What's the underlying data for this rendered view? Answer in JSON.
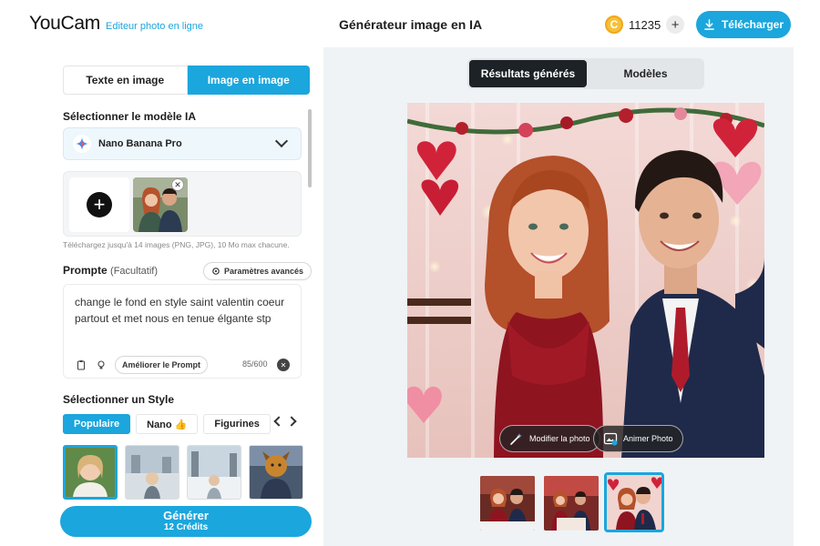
{
  "header": {
    "logo_word": "YouCam",
    "logo_sub": "Editeur photo en ligne",
    "title": "Générateur image en IA",
    "credits": "11235",
    "download_label": "Télécharger"
  },
  "left": {
    "tabs": [
      {
        "label": "Texte en image",
        "active": false
      },
      {
        "label": "Image en image",
        "active": true
      }
    ],
    "model_section_label": "Sélectionner le modèle IA",
    "model_name": "Nano Banana Pro",
    "upload_hint": "Téléchargez jusqu'à 14 images (PNG, JPG), 10 Mo max chacune.",
    "prompt_label": "Prompte",
    "prompt_optional": "(Facultatif)",
    "advanced_label": "Paramètres avancés",
    "prompt_text": "change le fond en style saint valentin coeur partout et met nous en tenue élgante stp",
    "improve_label": "Améliorer le Prompt",
    "char_count": "85/600",
    "style_section_label": "Sélectionner un Style",
    "style_tabs": [
      {
        "label": "Populaire",
        "active": true
      },
      {
        "label": "Nano 👍",
        "active": false
      },
      {
        "label": "Figurines",
        "active": false
      }
    ],
    "generate_label": "Générer",
    "generate_cost": "12 Crédits"
  },
  "right": {
    "segments": [
      {
        "label": "Résultats générés",
        "active": true
      },
      {
        "label": "Modèles",
        "active": false
      }
    ],
    "edit_photo_label": "Modifier la photo",
    "animate_photo_label": "Animer Photo"
  },
  "colors": {
    "accent": "#1ba6dd",
    "panel_bg": "#eff3f6",
    "dark_segment": "#1d2226"
  }
}
